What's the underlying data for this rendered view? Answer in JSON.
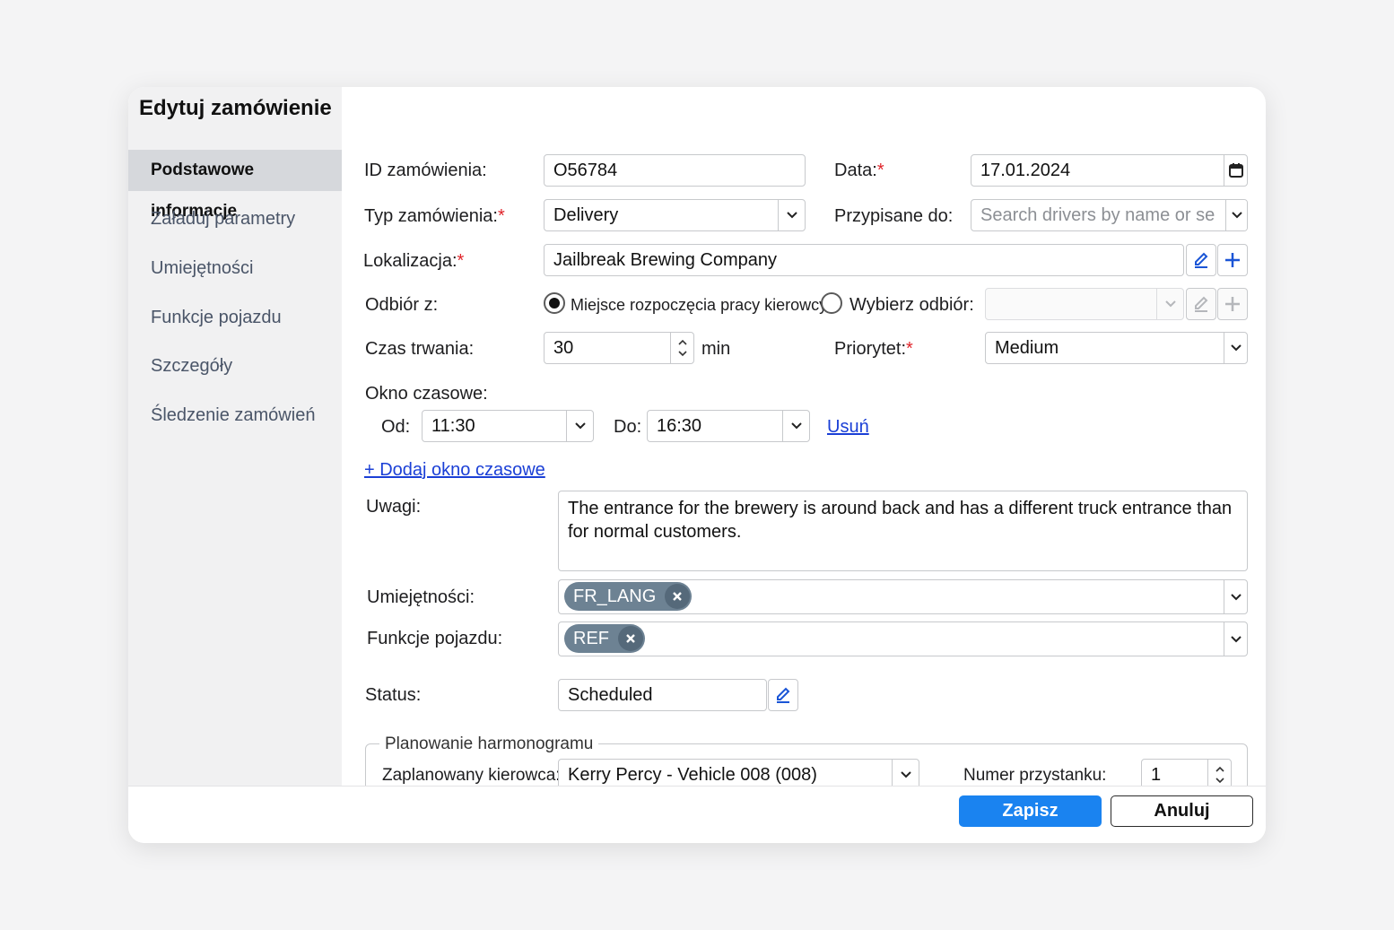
{
  "dialog": {
    "title": "Edytuj zamówienie"
  },
  "sidebar": {
    "items": [
      {
        "label": "Podstawowe informacje",
        "active": true
      },
      {
        "label": "Załaduj parametry"
      },
      {
        "label": "Umiejętności"
      },
      {
        "label": "Funkcje pojazdu"
      },
      {
        "label": "Szczegóły"
      },
      {
        "label": "Śledzenie zamówień"
      }
    ]
  },
  "form": {
    "order_id": {
      "label": "ID zamówienia:",
      "value": "O56784"
    },
    "date": {
      "label": "Data:",
      "value": "17.01.2024",
      "icon": "calendar-icon"
    },
    "order_type": {
      "label": "Typ zamówienia:",
      "value": "Delivery"
    },
    "assigned_to": {
      "label": "Przypisane do:",
      "placeholder": "Search drivers by name or se"
    },
    "location": {
      "label": "Lokalizacja:",
      "value": "Jailbreak Brewing Company"
    },
    "pickup": {
      "label": "Odbiór z:",
      "option_driver_start": "Miejsce rozpoczęcia pracy kierowcy",
      "option_choose": "Wybierz odbiór:",
      "selected": "option_driver_start"
    },
    "duration": {
      "label": "Czas trwania:",
      "value": "30",
      "unit": "min"
    },
    "priority": {
      "label": "Priorytet:",
      "value": "Medium"
    },
    "time_window": {
      "label": "Okno czasowe:",
      "from_label": "Od:",
      "from_value": "11:30",
      "to_label": "Do:",
      "to_value": "16:30",
      "remove_link": "Usuń",
      "add_link": "+ Dodaj okno czasowe"
    },
    "notes": {
      "label": "Uwagi:",
      "value": "The entrance for the brewery is around back and has a different truck entrance than for normal customers."
    },
    "skills": {
      "label": "Umiejętności:",
      "chips": [
        "FR_LANG"
      ]
    },
    "vehicle_features": {
      "label": "Funkcje pojazdu:",
      "chips": [
        "REF"
      ]
    },
    "status": {
      "label": "Status:",
      "value": "Scheduled"
    },
    "scheduling": {
      "legend": "Planowanie harmonogramu",
      "driver_label": "Zaplanowany kierowca:",
      "driver_value": "Kerry Percy - Vehicle 008 (008)",
      "stop_label": "Numer przystanku:",
      "stop_value": "1"
    }
  },
  "footer": {
    "save_label": "Zapisz",
    "cancel_label": "Anuluj"
  },
  "colors": {
    "primary": "#1a83f0",
    "link": "#1a3fd6",
    "required": "#e0242a",
    "chip": "#6d8293",
    "sidebar_active": "#d6d8dc"
  }
}
